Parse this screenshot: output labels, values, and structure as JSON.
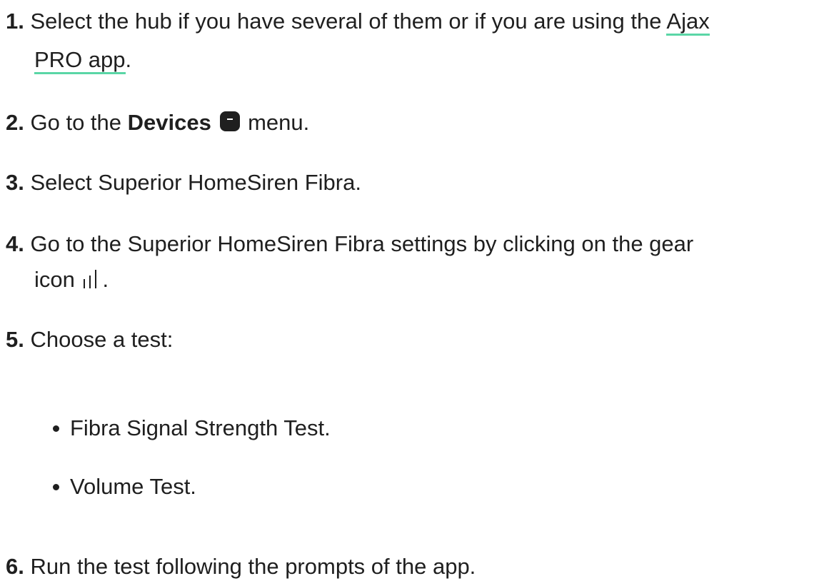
{
  "steps": [
    {
      "num": "1.",
      "text_before": "Select the hub if you have several of them or if you are using the ",
      "link_part1": "Ajax",
      "link_part2": "PRO app",
      "text_after": "."
    },
    {
      "num": "2.",
      "text_before": "Go to the ",
      "bold": "Devices",
      "icon": "devices-icon",
      "text_after": " menu."
    },
    {
      "num": "3.",
      "text": "Select Superior HomeSiren Fibra."
    },
    {
      "num": "4.",
      "text_line1": "Go to the Superior HomeSiren Fibra settings by clicking on the gear",
      "text_line2_before": "icon ",
      "icon": "gear-icon",
      "text_after": "."
    },
    {
      "num": "5.",
      "text": "Choose a test:",
      "bullets": [
        "Fibra Signal Strength Test.",
        "Volume Test."
      ]
    },
    {
      "num": "6.",
      "text": "Run the test following the prompts of the app."
    }
  ],
  "colors": {
    "text": "#1f1f1f",
    "link_underline": "#5ad6a6"
  }
}
